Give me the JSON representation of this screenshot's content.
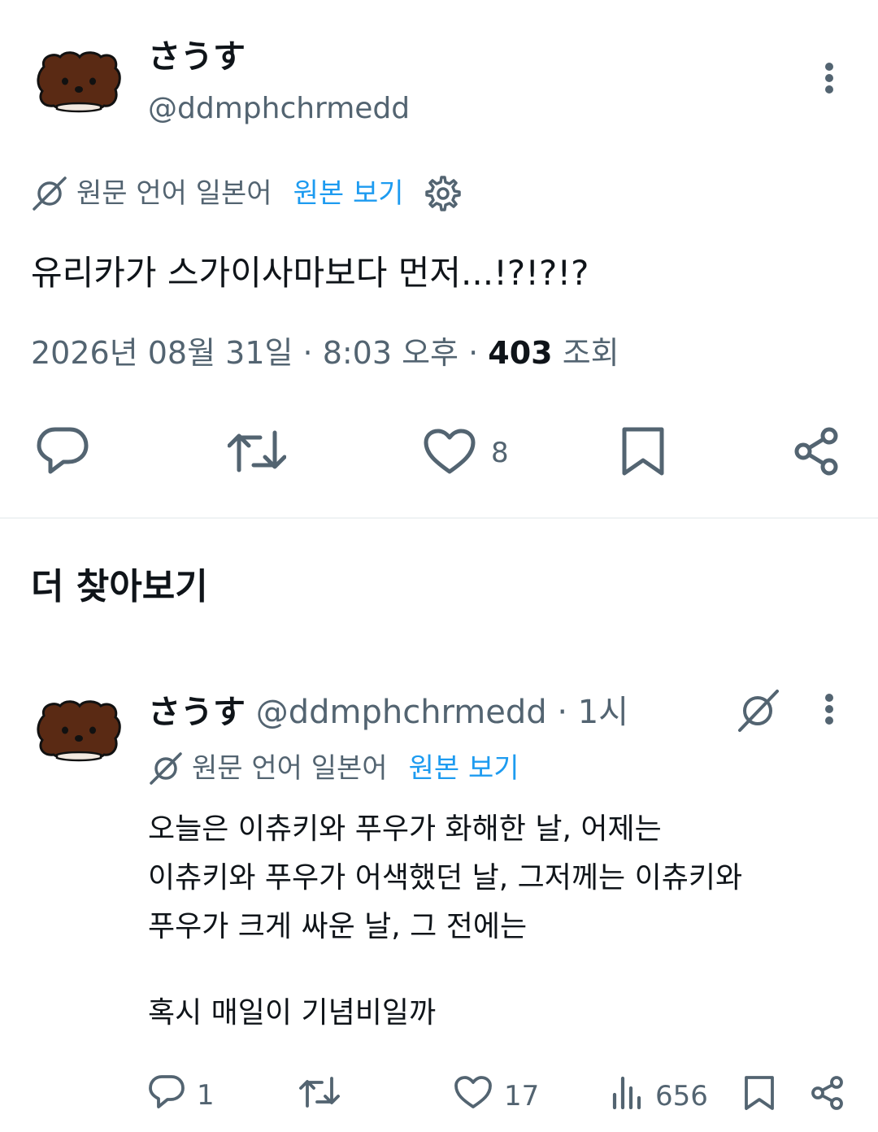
{
  "colors": {
    "primary_text": "#0f1419",
    "secondary_text": "#536471",
    "link_blue": "#1d9bf0",
    "avatar_brown": "#5a2a14",
    "divider": "#eff3f4"
  },
  "main_tweet": {
    "display_name": "さうす",
    "handle": "@ddmphchrmedd",
    "more_icon": "more-vertical-icon",
    "translation": {
      "icon": "translate-off-icon",
      "original_language": "원문 언어 일본어",
      "view_original": "원본 보기",
      "settings_icon": "gear-icon"
    },
    "text": "유리카가 스가이사마보다 먼저...!?!?!?",
    "date": "2026년 08월 31일 · 8:03 오후",
    "bullet": " · ",
    "views_count": "403",
    "views_label": "조회",
    "actions": {
      "reply_icon": "reply-icon",
      "retweet_icon": "retweet-icon",
      "like_icon": "heart-icon",
      "like_count": "8",
      "bookmark_icon": "bookmark-icon",
      "share_icon": "share-icon"
    }
  },
  "discover": {
    "title": "더 찾아보기"
  },
  "reply_tweet": {
    "display_name": "さうす",
    "handle": "@ddmphchrmedd",
    "time": "· 1시",
    "translation": {
      "original_language": "원문 언어 일본어",
      "view_original": "원본 보기"
    },
    "lines": [
      "오늘은 이츄키와 푸우가 화해한 날, 어제는",
      "이츄키와 푸우가 어색했던 날, 그저께는 이츄키와",
      "푸우가 크게 싸운 날, 그 전에는",
      "",
      "혹시 매일이 기념비일까"
    ],
    "actions": {
      "reply_count": "1",
      "retweet_count": "",
      "like_count": "17",
      "views_count": "656"
    }
  }
}
